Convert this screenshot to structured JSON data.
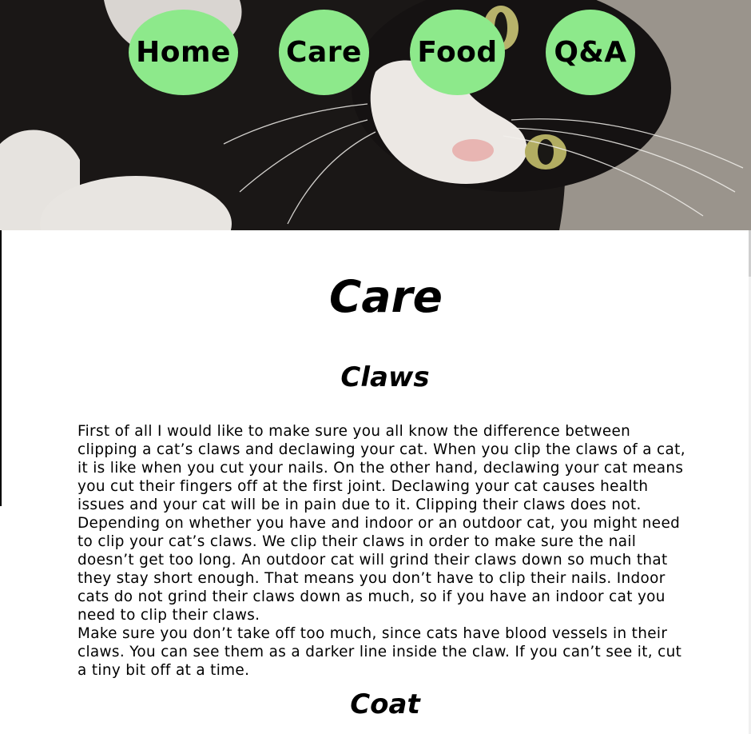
{
  "nav": {
    "items": [
      {
        "label": "Home"
      },
      {
        "label": "Care"
      },
      {
        "label": "Food"
      },
      {
        "label": "Q&A"
      }
    ],
    "button_color": "#8de98b"
  },
  "main": {
    "title": "Care",
    "sections": [
      {
        "heading": "Claws",
        "paragraphs": [
          "First of all I would like to make sure you all know the difference between clipping a cat’s claws and declawing your cat. When you clip the claws of a cat, it is like when you cut your nails. On the other hand, declawing your cat means you cut their fingers off at the first joint. Declawing your cat causes health issues and your cat will be in pain due to it. Clipping their claws does not. Depending on whether you have and indoor or an outdoor cat, you might need to clip your cat’s claws. We clip their claws in order to make sure the nail doesn’t get too long. An outdoor cat will grind their claws down so much that they stay short enough. That means you don’t have to clip their nails. Indoor cats do not grind their claws down as much, so if you have an indoor cat you need to clip their claws.",
          "Make sure you don’t take off too much, since cats have blood vessels in their claws. You can see them as a darker line inside the claw. If you can’t see it, cut a tiny bit off at a time."
        ]
      },
      {
        "heading": "Coat"
      }
    ]
  }
}
